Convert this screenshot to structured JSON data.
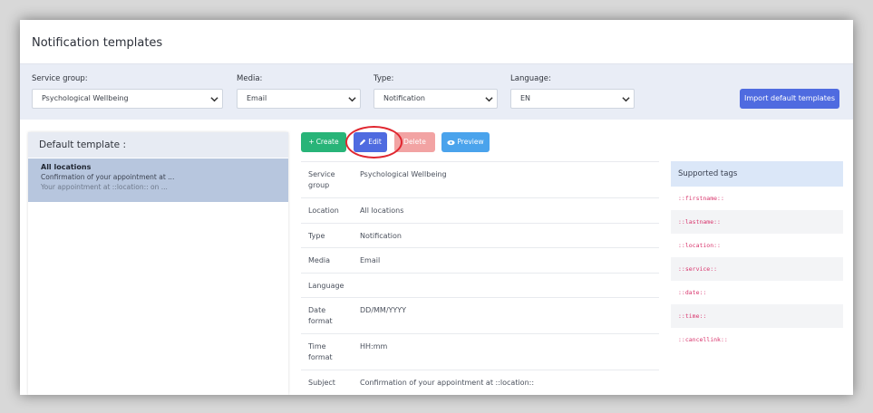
{
  "page": {
    "title": "Notification templates"
  },
  "filters": {
    "service_group": {
      "label": "Service group:",
      "value": "Psychological Wellbeing"
    },
    "media": {
      "label": "Media:",
      "value": "Email"
    },
    "type": {
      "label": "Type:",
      "value": "Notification"
    },
    "language": {
      "label": "Language:",
      "value": "EN"
    },
    "import_label": "Import default templates"
  },
  "left_panel": {
    "title": "Default template :",
    "item": {
      "title": "All locations",
      "subtitle": "Confirmation of your appointment at ...",
      "preview": "Your appointment at ::location:: on ..."
    }
  },
  "toolbar": {
    "create_label": "Create",
    "edit_label": "Edit",
    "delete_label": "Delete",
    "preview_label": "Preview"
  },
  "details": {
    "service_group_key": "Service group",
    "service_group_val": "Psychological Wellbeing",
    "location_key": "Location",
    "location_val": "All locations",
    "type_key": "Type",
    "type_val": "Notification",
    "media_key": "Media",
    "media_val": "Email",
    "language_key": "Language",
    "language_val": "",
    "date_format_key": "Date format",
    "date_format_val": "DD/MM/YYYY",
    "time_format_key": "Time format",
    "time_format_val": "HH:mm",
    "subject_key": "Subject",
    "subject_val": "Confirmation of your appointment at ::location::"
  },
  "tags": {
    "title": "Supported tags",
    "items": [
      "::firstname::",
      "::lastname::",
      "::location::",
      "::service::",
      "::date::",
      "::time::",
      "::cancellink::"
    ]
  },
  "colors": {
    "primary": "#4f6be0",
    "success": "#28b478",
    "danger_light": "#f2a3a3",
    "info": "#4aa3ec",
    "highlight": "#e0262f"
  }
}
